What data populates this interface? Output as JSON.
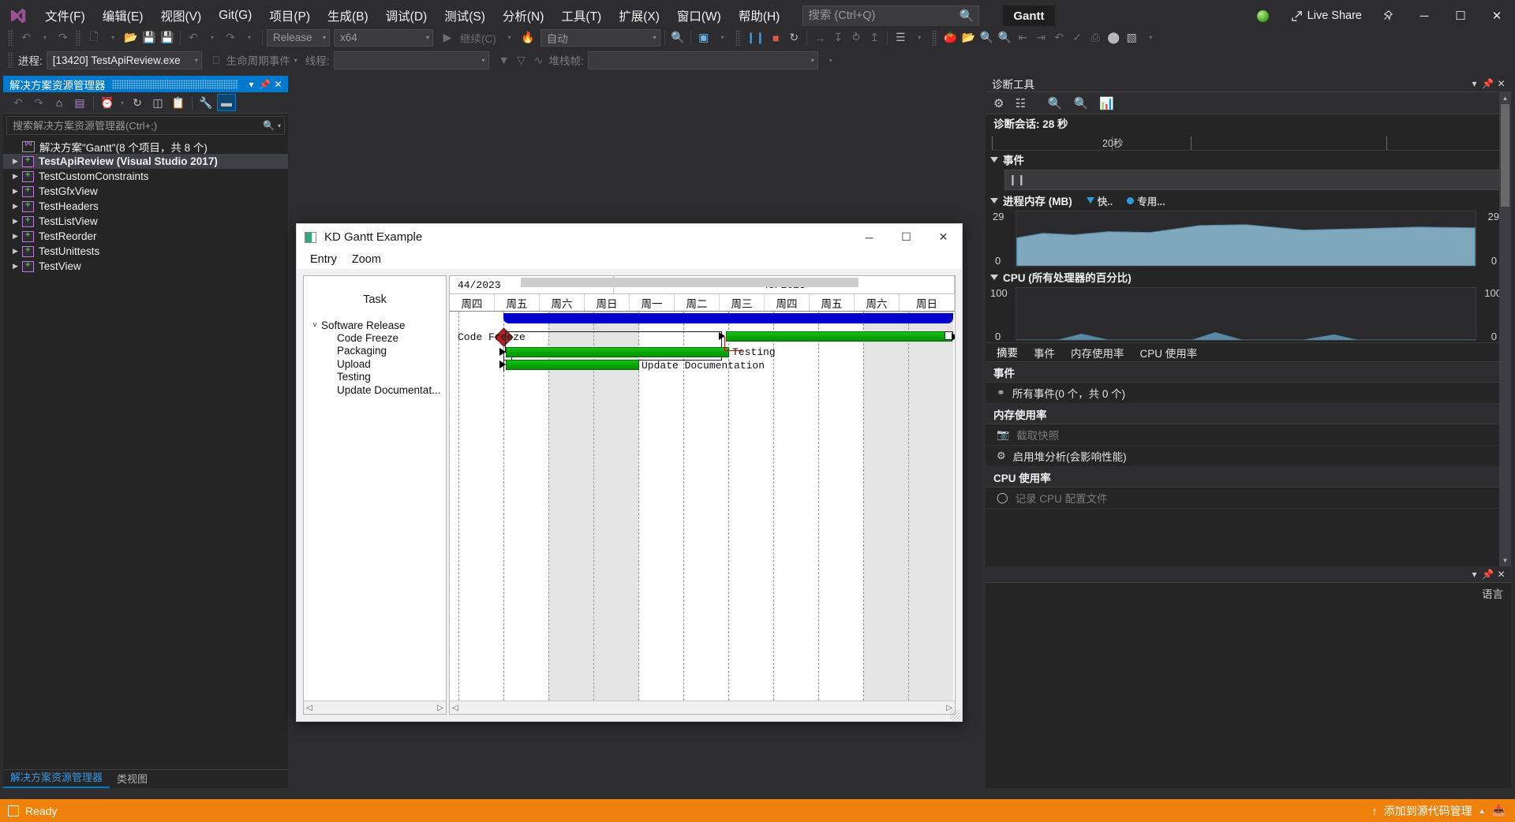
{
  "titlebar": {
    "menus": [
      "文件(F)",
      "编辑(E)",
      "视图(V)",
      "Git(G)",
      "项目(P)",
      "生成(B)",
      "调试(D)",
      "测试(S)",
      "分析(N)",
      "工具(T)",
      "扩展(X)",
      "窗口(W)",
      "帮助(H)"
    ],
    "search_placeholder": "搜索 (Ctrl+Q)",
    "search_value": "",
    "solution_name": "Gantt",
    "live_share": "Live Share",
    "minimize": "─",
    "maximize": "☐",
    "close": "✕"
  },
  "toolbar1": {
    "config": "Release",
    "platform": "x64",
    "run_label": "继续(C)",
    "attach_label": "自动"
  },
  "toolbar2": {
    "process_label": "进程:",
    "process_value": "[13420] TestApiReview.exe",
    "lifecycle_label": "生命周期事件",
    "thread_label": "线程:",
    "thread_value": "",
    "stackframe_label": "堆栈帧:",
    "stackframe_value": ""
  },
  "solution_explorer": {
    "title": "解决方案资源管理器",
    "search_placeholder": "搜索解决方案资源管理器(Ctrl+;)",
    "solution_node": "解决方案\"Gantt\"(8 个项目，共 8 个)",
    "projects": [
      {
        "name": "TestApiReview (Visual Studio 2017)",
        "selected": true
      },
      {
        "name": "TestCustomConstraints",
        "selected": false
      },
      {
        "name": "TestGfxView",
        "selected": false
      },
      {
        "name": "TestHeaders",
        "selected": false
      },
      {
        "name": "TestListView",
        "selected": false
      },
      {
        "name": "TestReorder",
        "selected": false
      },
      {
        "name": "TestUnittests",
        "selected": false
      },
      {
        "name": "TestView",
        "selected": false
      }
    ],
    "tabs": [
      {
        "label": "解决方案资源管理器",
        "active": true
      },
      {
        "label": "类视图",
        "active": false
      }
    ]
  },
  "gantt_window": {
    "title": "KD Gantt Example",
    "menus": [
      "Entry",
      "Zoom"
    ],
    "task_column_header": "Task",
    "minimize": "─",
    "maximize": "☐",
    "close": "✕"
  },
  "chart_data": {
    "type": "bar",
    "title": "KD Gantt Example",
    "xlabel": "",
    "ylabel": "Task",
    "week_headers": [
      "44/2023",
      "45/2023"
    ],
    "day_headers": [
      "周四",
      "周五",
      "周六",
      "周日",
      "周一",
      "周二",
      "周三",
      "周四",
      "周五",
      "周六",
      "周日"
    ],
    "weekend_columns": [
      2,
      3,
      9,
      10
    ],
    "categories": [
      "Software Release",
      "Code Freeze",
      "Packaging",
      "Upload",
      "Testing",
      "Update Documentat..."
    ],
    "tasks": [
      {
        "name": "Software Release",
        "type": "summary",
        "indent": 0,
        "expanded": true,
        "start_col": 1.05,
        "end_col": 11.0,
        "color": "#0000cd"
      },
      {
        "name": "Code Freeze",
        "type": "milestone",
        "indent": 1,
        "start_col": 1.0,
        "color": "#b22222"
      },
      {
        "name": "Packaging",
        "type": "task",
        "indent": 1,
        "start_col": 1.05,
        "end_col": 6.0,
        "color": "#ffffff"
      },
      {
        "name": "Upload",
        "type": "task",
        "indent": 1,
        "start_col": 6.1,
        "end_col": 11.0,
        "color": "#0aa80a"
      },
      {
        "name": "Testing",
        "type": "task",
        "indent": 1,
        "start_col": 1.05,
        "end_col": 5.9,
        "color": "#0aa80a",
        "label": "Testing"
      },
      {
        "name": "Update Documentat...",
        "type": "task",
        "indent": 1,
        "start_col": 1.05,
        "end_col": 4.55,
        "color": "#0aa80a",
        "label": "Update Documentation"
      }
    ],
    "bar_labels": [
      "Code Freeze",
      "Testing",
      "Update Documentation"
    ],
    "legend": []
  },
  "diagnostics": {
    "title": "诊断工具",
    "session_label": "诊断会话: 28 秒",
    "scale_label": "20秒",
    "events_section": "事件",
    "memory_section": "进程内存 (MB)",
    "memory_legend_1": "快..",
    "memory_legend_2": "专用...",
    "memory_max": "29",
    "memory_min": "0",
    "cpu_section": "CPU (所有处理器的百分比)",
    "cpu_max": "100",
    "cpu_min": "0",
    "tabs": [
      {
        "label": "摘要",
        "active": true
      },
      {
        "label": "事件",
        "active": false
      },
      {
        "label": "内存使用率",
        "active": false
      },
      {
        "label": "CPU 使用率",
        "active": false
      }
    ],
    "sections": [
      {
        "header": "事件",
        "rows": [
          {
            "icon": "events-icon",
            "text": "所有事件(0 个，共 0 个)",
            "dim": false
          }
        ]
      },
      {
        "header": "内存使用率",
        "rows": [
          {
            "icon": "camera-icon",
            "text": "截取快照",
            "dim": true
          },
          {
            "icon": "heap-icon",
            "text": "启用堆分析(会影响性能)",
            "dim": false
          }
        ]
      },
      {
        "header": "CPU 使用率",
        "rows": [
          {
            "icon": "record-icon",
            "text": "记录 CPU 配置文件",
            "dim": true
          }
        ]
      }
    ]
  },
  "lower_pane": {
    "language_label": "语言"
  },
  "statusbar": {
    "ready": "Ready",
    "source_control": "添加到源代码管理"
  }
}
